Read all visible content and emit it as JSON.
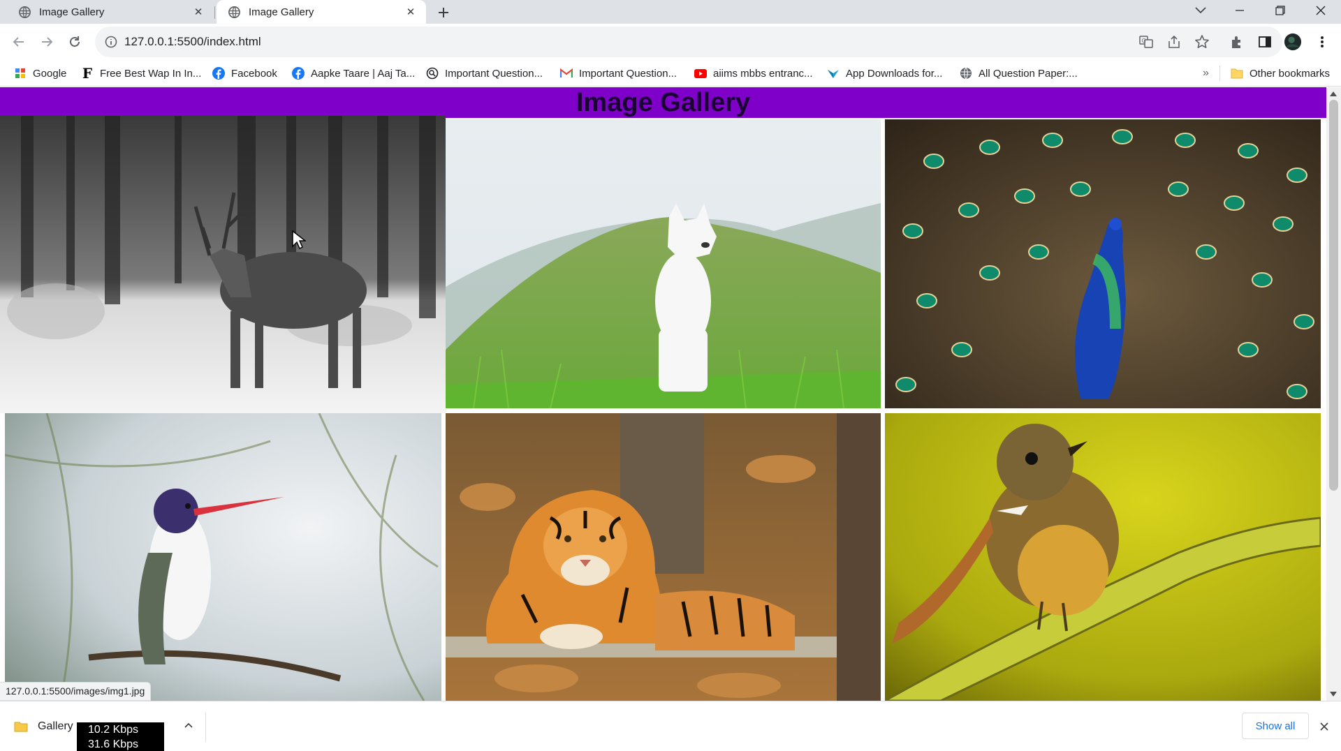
{
  "browser": {
    "tabs": [
      {
        "title": "Image Gallery",
        "active": false
      },
      {
        "title": "Image Gallery",
        "active": true
      }
    ],
    "url": "127.0.0.1:5500/index.html",
    "bookmarks": [
      {
        "label": "Google",
        "icon": "google-apps-icon"
      },
      {
        "label": "Free Best Wap In In...",
        "icon": "f-letter-icon"
      },
      {
        "label": "Facebook",
        "icon": "facebook-icon"
      },
      {
        "label": "Aapke Taare | Aaj Ta...",
        "icon": "facebook-icon"
      },
      {
        "label": "Important Question...",
        "icon": "search-site-icon"
      },
      {
        "label": "Important Question...",
        "icon": "gmail-icon"
      },
      {
        "label": "aiims mbbs entranc...",
        "icon": "youtube-icon"
      },
      {
        "label": "App Downloads for...",
        "icon": "app-icon"
      },
      {
        "label": "All Question Paper:...",
        "icon": "globe-icon"
      }
    ],
    "bookmarks_overflow": "»",
    "other_bookmarks": "Other bookmarks",
    "status_url": "127.0.0.1:5500/images/img1.jpg"
  },
  "page": {
    "heading": "Image Gallery",
    "images": [
      {
        "subject": "reindeer in snowy forest"
      },
      {
        "subject": "white husky on grassy hill"
      },
      {
        "subject": "peacock with fanned tail"
      },
      {
        "subject": "hummingbird on branch"
      },
      {
        "subject": "tiger lying in forest"
      },
      {
        "subject": "small bird on yellow branch"
      }
    ]
  },
  "downloads": {
    "item_name": "Gallery",
    "net_down": "10.2 Kbps",
    "net_up": "31.6 Kbps",
    "show_all": "Show all"
  },
  "colors": {
    "header_bg": "#7f00c8",
    "tabstrip_bg": "#dee1e6",
    "link_blue": "#1a73e8"
  }
}
